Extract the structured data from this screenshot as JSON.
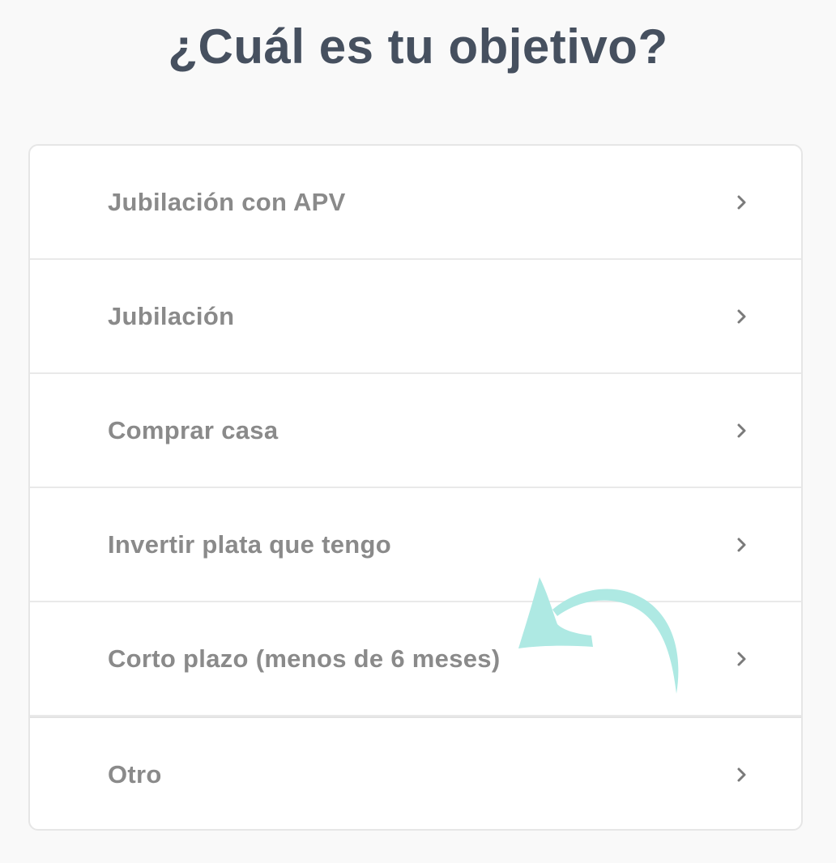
{
  "header": {
    "title": "¿Cuál es tu objetivo?"
  },
  "options": [
    {
      "label": "Jubilación con APV",
      "icon": "chevron-right-icon"
    },
    {
      "label": "Jubilación",
      "icon": "chevron-right-icon"
    },
    {
      "label": "Comprar casa",
      "icon": "chevron-right-icon"
    },
    {
      "label": "Invertir plata que tengo",
      "icon": "chevron-right-icon"
    },
    {
      "label": "Corto plazo (menos de 6 meses)",
      "icon": "chevron-right-icon"
    },
    {
      "label": "Otro",
      "icon": "chevron-right-icon"
    }
  ],
  "decoration": {
    "icon": "curved-arrow-icon",
    "color": "#aee9e3"
  },
  "colors": {
    "title": "#46505f",
    "option_text": "#8a8a8a",
    "chevron": "#7a7a7a",
    "background": "#f9f9f9"
  }
}
